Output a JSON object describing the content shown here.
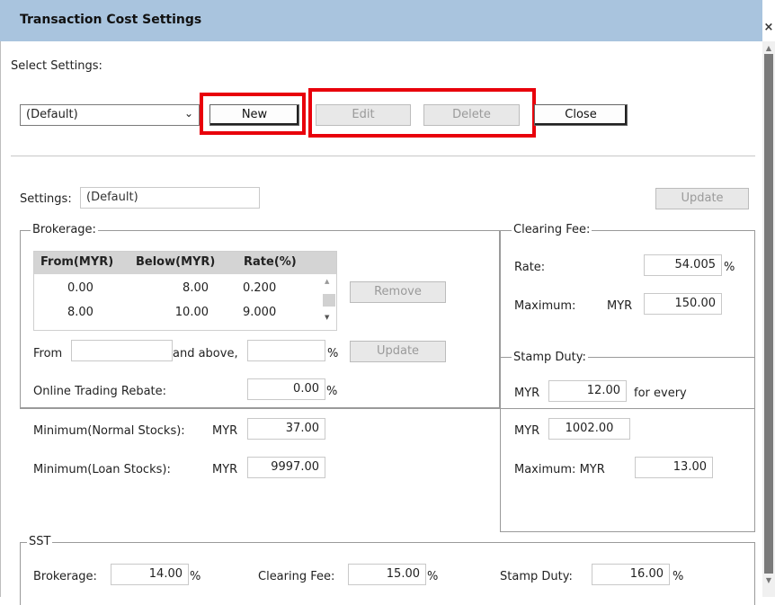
{
  "window": {
    "title": "Transaction Cost Settings",
    "close_glyph": "×"
  },
  "select_settings": {
    "label": "Select Settings:",
    "value": "(Default)",
    "chevron": "⌄"
  },
  "buttons": {
    "new": "New",
    "edit": "Edit",
    "delete": "Delete",
    "close": "Close",
    "update_top": "Update",
    "remove": "Remove",
    "update_brokerage": "Update"
  },
  "settings": {
    "label": "Settings:",
    "value": "(Default)"
  },
  "brokerage": {
    "legend": "Brokerage:",
    "columns": [
      "From(MYR)",
      "Below(MYR)",
      "Rate(%)"
    ],
    "rows": [
      {
        "from": "0.00",
        "below": "8.00",
        "rate": "0.200"
      },
      {
        "from": "8.00",
        "below": "10.00",
        "rate": "9.000"
      }
    ],
    "from_label": "From",
    "and_above_label": "and above,",
    "percent": "%",
    "online_rebate_label": "Online Trading Rebate:",
    "online_rebate_value": "0.00",
    "min_normal_label": "Minimum(Normal Stocks):",
    "min_normal_currency": "MYR",
    "min_normal_value": "37.00",
    "min_loan_label": "Minimum(Loan Stocks):",
    "min_loan_currency": "MYR",
    "min_loan_value": "9997.00"
  },
  "clearing_fee": {
    "legend": "Clearing Fee:",
    "rate_label": "Rate:",
    "rate_value": "54.005",
    "percent": "%",
    "max_label": "Maximum:",
    "max_currency": "MYR",
    "max_value": "150.00"
  },
  "stamp_duty": {
    "legend": "Stamp Duty:",
    "currency1": "MYR",
    "value1": "12.00",
    "for_every": "for every",
    "currency2": "MYR",
    "value2": "1002.00",
    "max_label": "Maximum: MYR",
    "max_value": "13.00"
  },
  "sst": {
    "legend": "SST",
    "brokerage_label": "Brokerage:",
    "brokerage_value": "14.00",
    "clearing_label": "Clearing Fee:",
    "clearing_value": "15.00",
    "stamp_label": "Stamp Duty:",
    "stamp_value": "16.00",
    "percent": "%"
  },
  "colors": {
    "titlebar": "#a9c4de",
    "highlight": "#e8000b"
  }
}
